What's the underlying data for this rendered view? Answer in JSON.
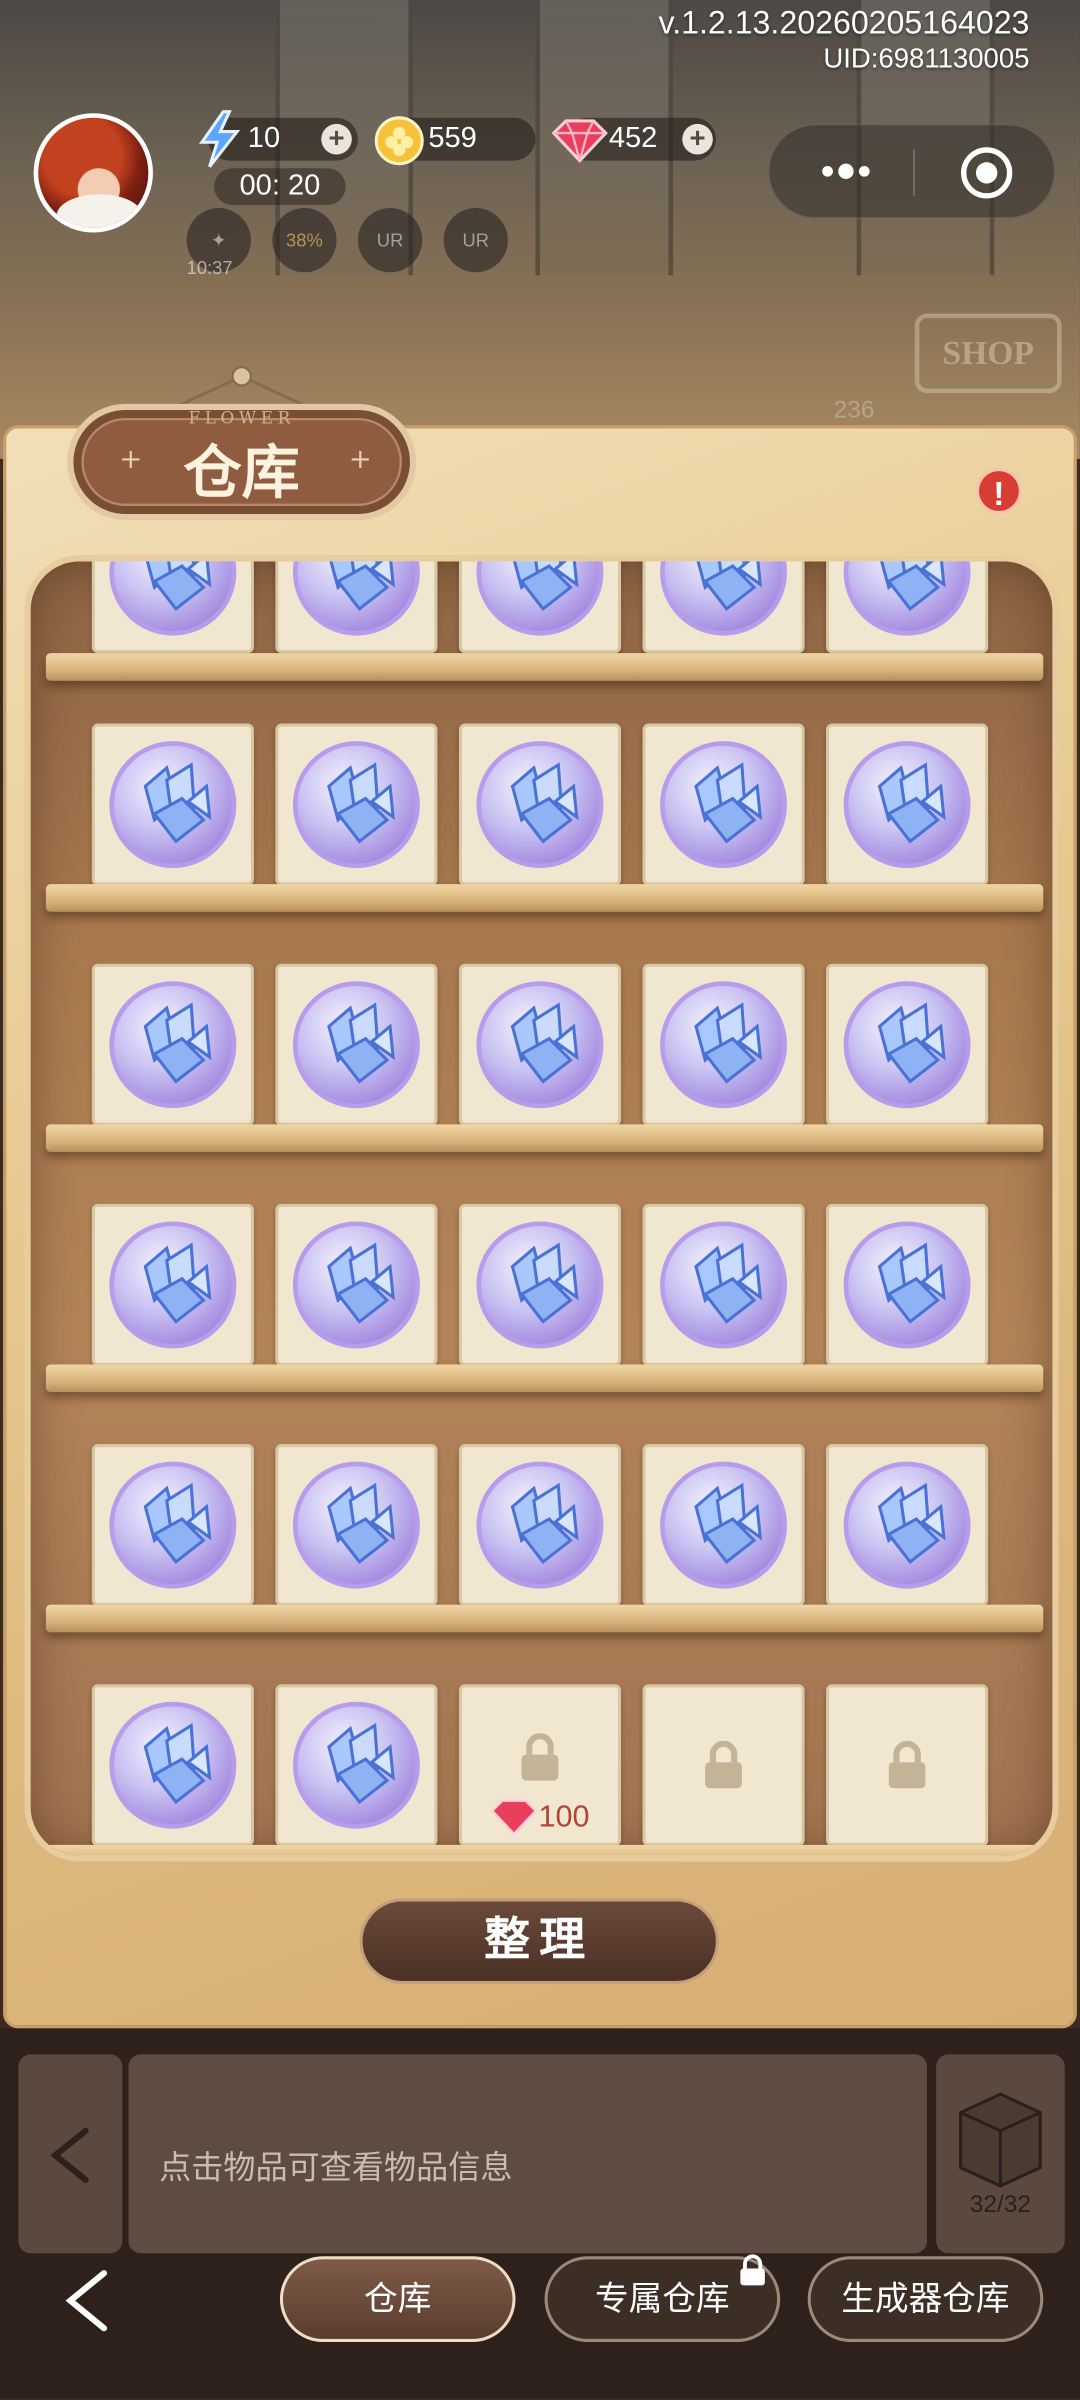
{
  "header": {
    "version": "v.1.2.13.20260205164023",
    "uid": "UID:6981130005"
  },
  "resources": {
    "energy": "10",
    "coins": "559",
    "gems": "452",
    "energy_timer": "00: 20",
    "buff_timer": "10:37",
    "buff_percent": "38%"
  },
  "title": {
    "label": "仓库",
    "subtitle": "FLOWER"
  },
  "alert": "!",
  "shop": {
    "sign": "SHOP",
    "count": "236"
  },
  "grid": {
    "item_name": "crystal-orb",
    "filled_slots": 27,
    "locked_slots": 3,
    "unlock_price": "100"
  },
  "sort_button": "整理",
  "info_text": "点击物品可查看物品信息",
  "box_count": "32/32",
  "tabs": [
    {
      "label": "仓库",
      "active": true
    },
    {
      "label": "专属仓库",
      "active": false,
      "locked": true
    },
    {
      "label": "生成器仓库",
      "active": false
    }
  ],
  "colors": {
    "accent_brown": "#5a3d2f",
    "gem_red": "#d83d33",
    "panel": "#e7c98f"
  }
}
